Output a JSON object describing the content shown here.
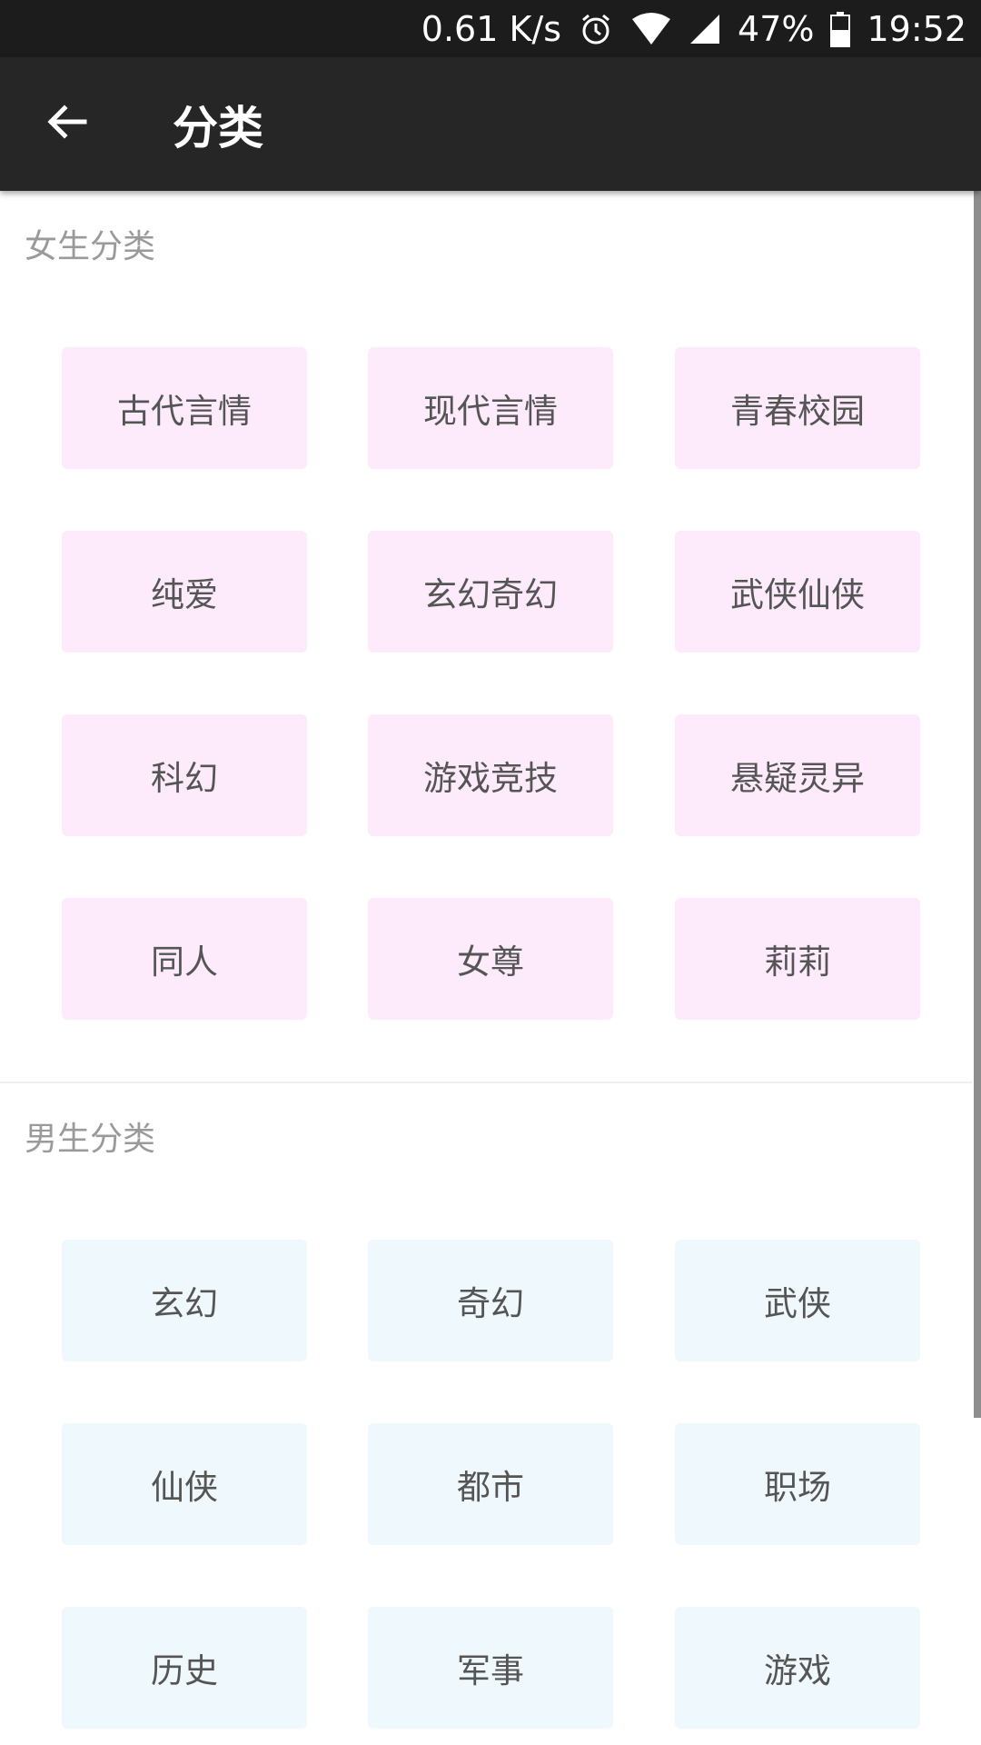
{
  "status_bar": {
    "net_speed": "0.61 K/s",
    "battery": "47%",
    "time": "19:52",
    "icons": [
      "alarm-icon",
      "wifi-icon",
      "signal-icon",
      "battery-icon"
    ]
  },
  "app_bar": {
    "back_icon": "arrow-left-icon",
    "title": "分类"
  },
  "sections": {
    "female": {
      "title": "女生分类",
      "color": "#fdebfb",
      "items": [
        "古代言情",
        "现代言情",
        "青春校园",
        "纯爱",
        "玄幻奇幻",
        "武侠仙侠",
        "科幻",
        "游戏竞技",
        "悬疑灵异",
        "同人",
        "女尊",
        "莉莉"
      ]
    },
    "male": {
      "title": "男生分类",
      "color": "#eff8fc",
      "items": [
        "玄幻",
        "奇幻",
        "武侠",
        "仙侠",
        "都市",
        "职场",
        "历史",
        "军事",
        "游戏"
      ]
    }
  }
}
